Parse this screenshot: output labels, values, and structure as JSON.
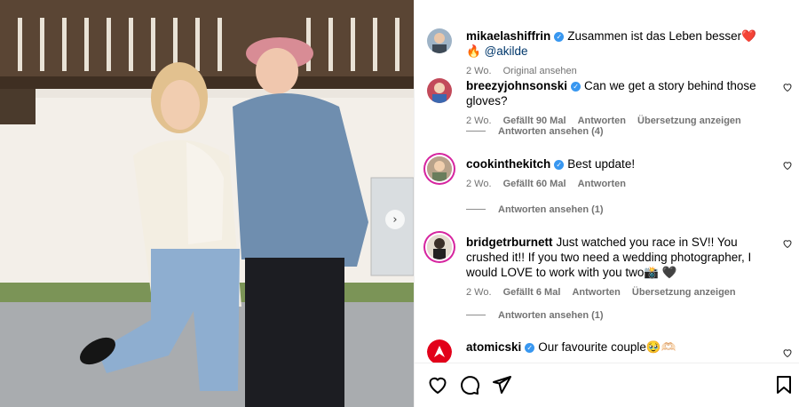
{
  "post": {
    "caption": {
      "username": "mikaelashiffrin",
      "text": "Zusammen ist das Leben besser",
      "emoji_heart": "❤️",
      "emoji_fire": "🔥",
      "mention": "@akilde",
      "time": "2 Wo.",
      "see_translation": "Original ansehen"
    },
    "comments": [
      {
        "username": "breezyjohnsonski",
        "verified": true,
        "text": "Can we get a story behind those gloves?",
        "time": "2 Wo.",
        "likes": "Gefällt 90 Mal",
        "reply": "Antworten",
        "translate": "Übersetzung anzeigen",
        "view_replies": "Antworten ansehen (4)"
      },
      {
        "username": "cookinthekitch",
        "verified": true,
        "text": "Best update!",
        "time": "2 Wo.",
        "likes": "Gefällt 60 Mal",
        "reply": "Antworten",
        "view_replies": "Antworten ansehen (1)"
      },
      {
        "username": "bridgetrburnett",
        "verified": false,
        "text": "Just watched you race in SV!! You crushed it!! If you two need a wedding photographer, I would LOVE to work with you two📸 🖤",
        "time": "2 Wo.",
        "likes": "Gefällt 6 Mal",
        "reply": "Antworten",
        "translate": "Übersetzung anzeigen",
        "view_replies": "Antworten ansehen (1)"
      },
      {
        "username": "atomicski",
        "verified": true,
        "text": "Our favourite couple🥹🫶🏻"
      }
    ]
  },
  "icons": {
    "like": "heart-icon",
    "comment": "comment-icon",
    "share": "share-icon",
    "save": "bookmark-icon",
    "next": "chevron-right-icon"
  },
  "colors": {
    "verified": "#3897f0",
    "secondary_text": "#737373",
    "mention": "#00376b",
    "atomic_red": "#e2001a"
  },
  "carousel_next_glyph": "›"
}
